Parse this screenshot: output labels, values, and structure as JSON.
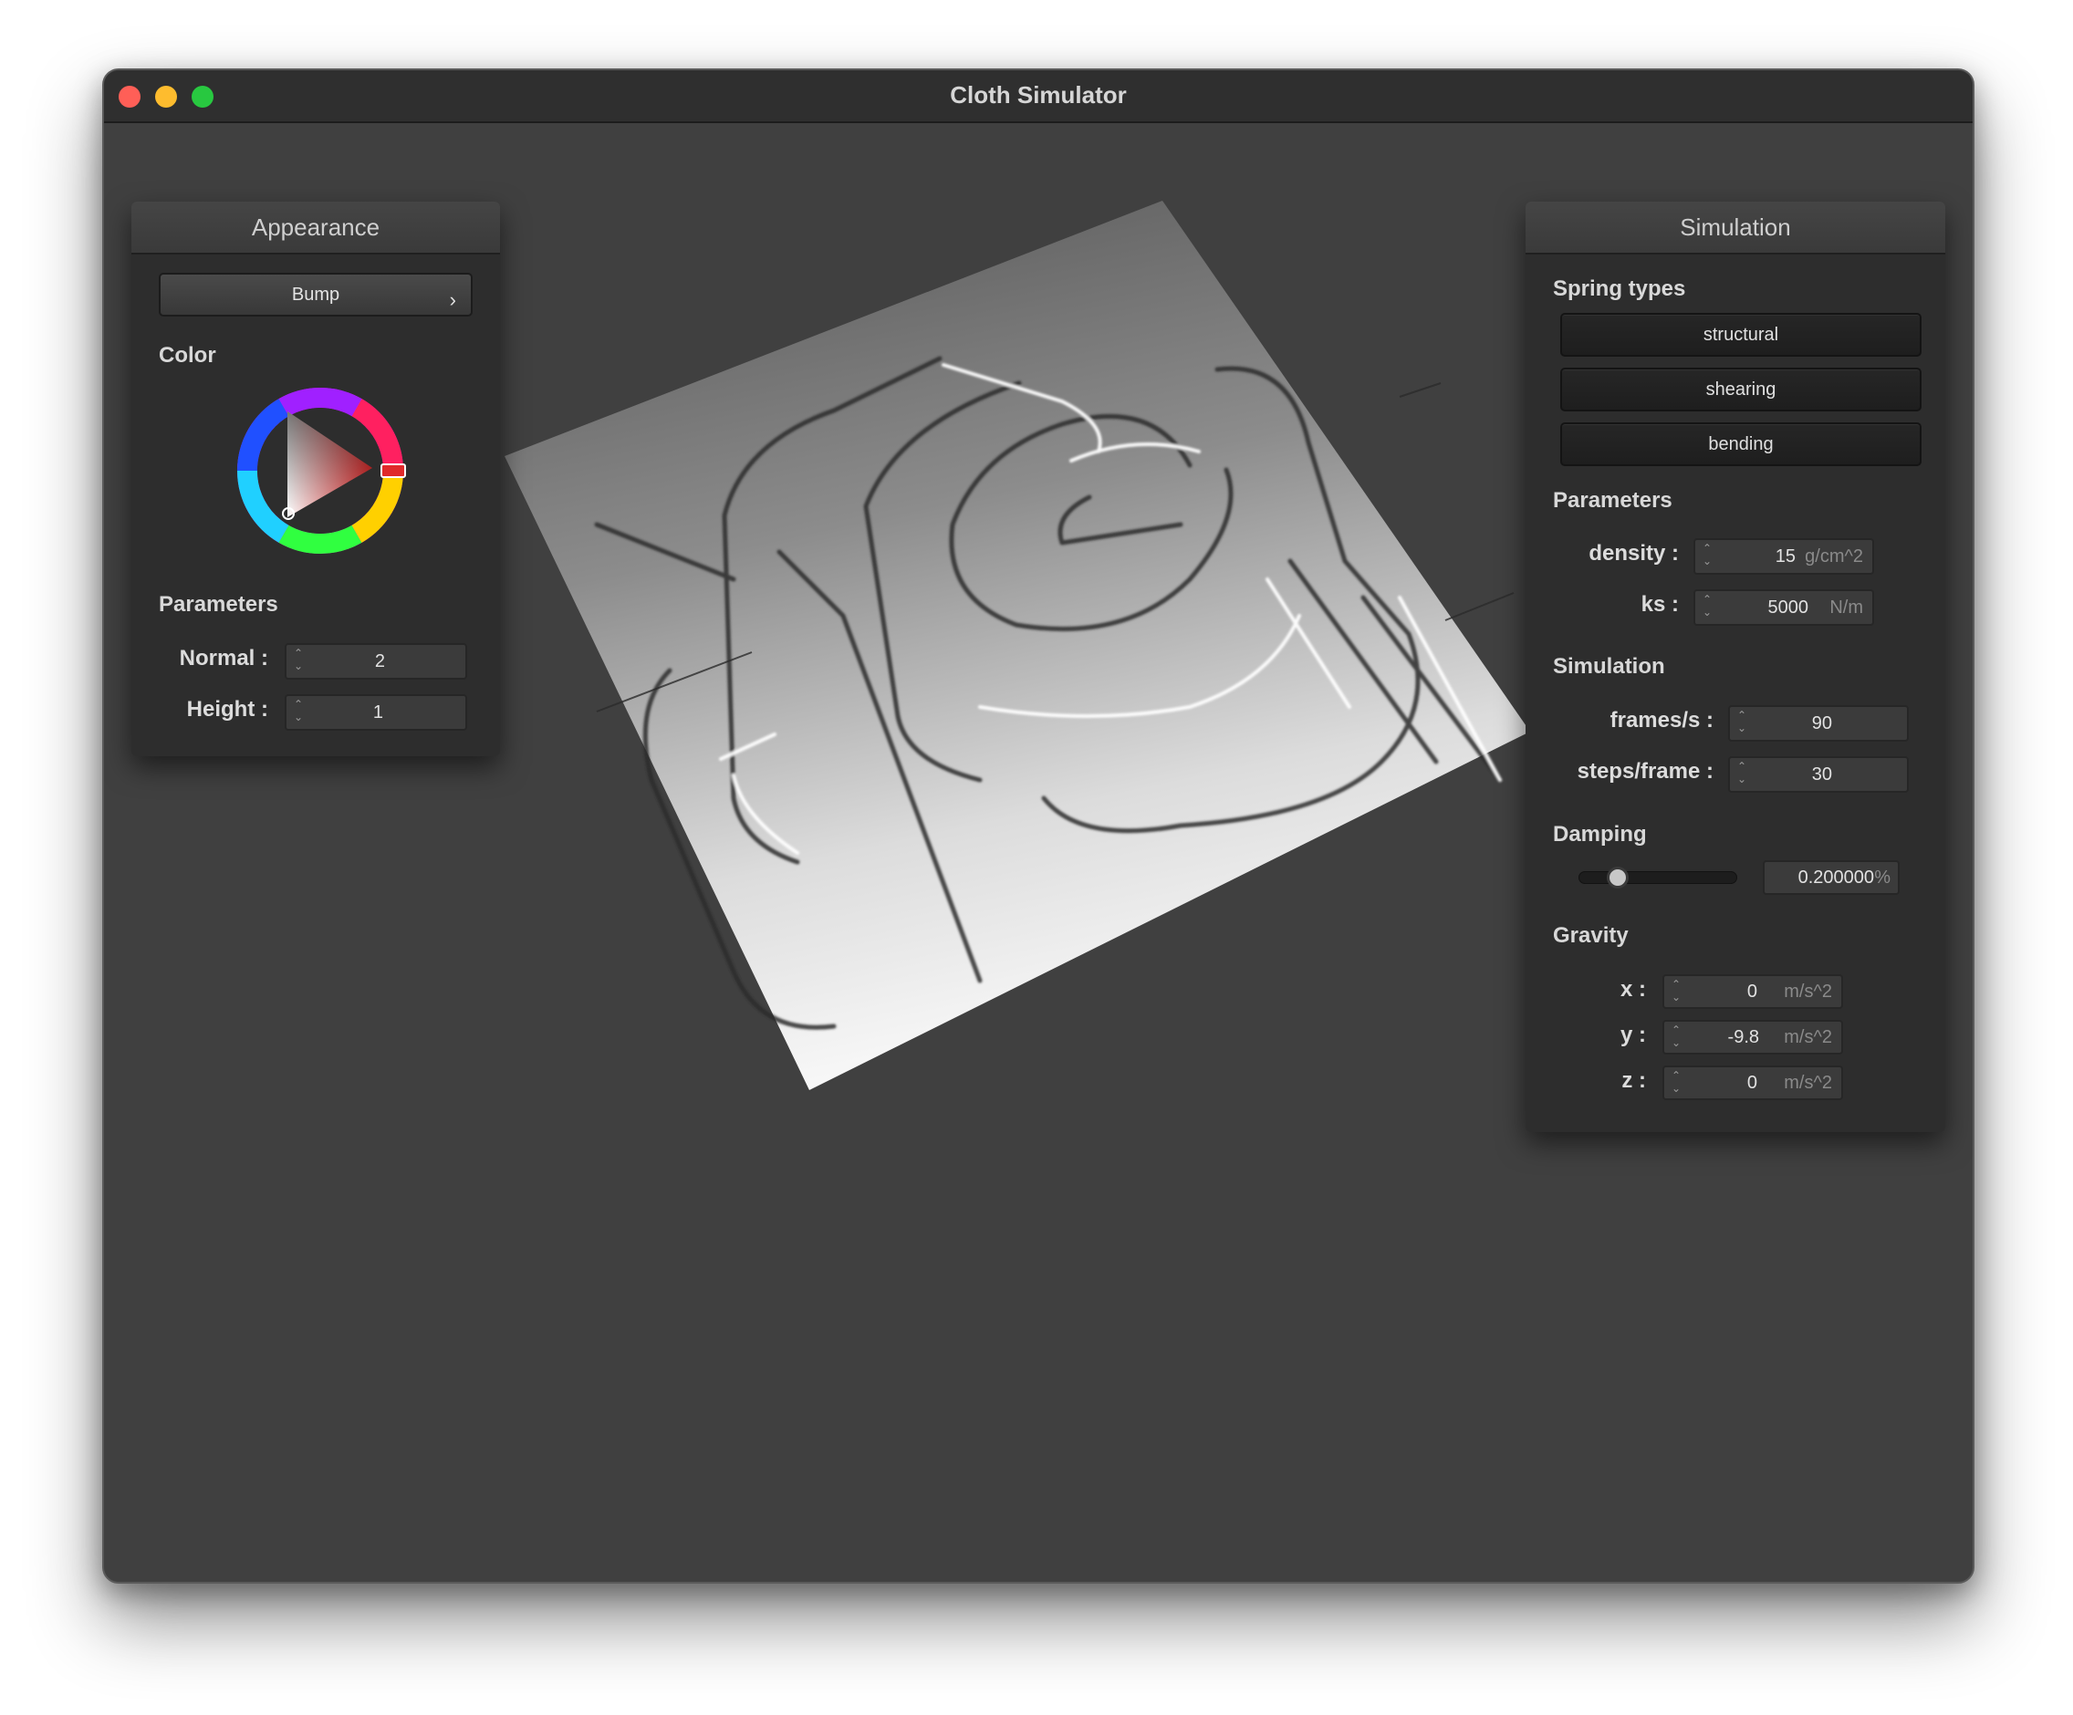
{
  "window": {
    "title": "Cloth Simulator"
  },
  "appearance": {
    "header": "Appearance",
    "shader_dropdown": {
      "selected": "Bump",
      "chevron": "›"
    },
    "color_label": "Color",
    "color": "#e02a2a",
    "parameters_label": "Parameters",
    "normal": {
      "label": "Normal :",
      "value": "2"
    },
    "height": {
      "label": "Height :",
      "value": "1"
    }
  },
  "simulation": {
    "header": "Simulation",
    "spring_types_label": "Spring types",
    "spring_types": [
      "structural",
      "shearing",
      "bending"
    ],
    "parameters_label": "Parameters",
    "density": {
      "label": "density :",
      "value": "15",
      "unit": "g/cm^2"
    },
    "ks": {
      "label": "ks :",
      "value": "5000",
      "unit": "N/m"
    },
    "simulation_label": "Simulation",
    "frames_per_s": {
      "label": "frames/s :",
      "value": "90"
    },
    "steps_per_frame": {
      "label": "steps/frame :",
      "value": "30"
    },
    "damping_label": "Damping",
    "damping": {
      "level_fraction": 0.2,
      "value": "0.200000",
      "unit": "%"
    },
    "gravity_label": "Gravity",
    "gravity": {
      "x": {
        "label": "x :",
        "value": "0",
        "unit": "m/s^2"
      },
      "y": {
        "label": "y :",
        "value": "-9.8",
        "unit": "m/s^2"
      },
      "z": {
        "label": "z :",
        "value": "0",
        "unit": "m/s^2"
      }
    }
  }
}
